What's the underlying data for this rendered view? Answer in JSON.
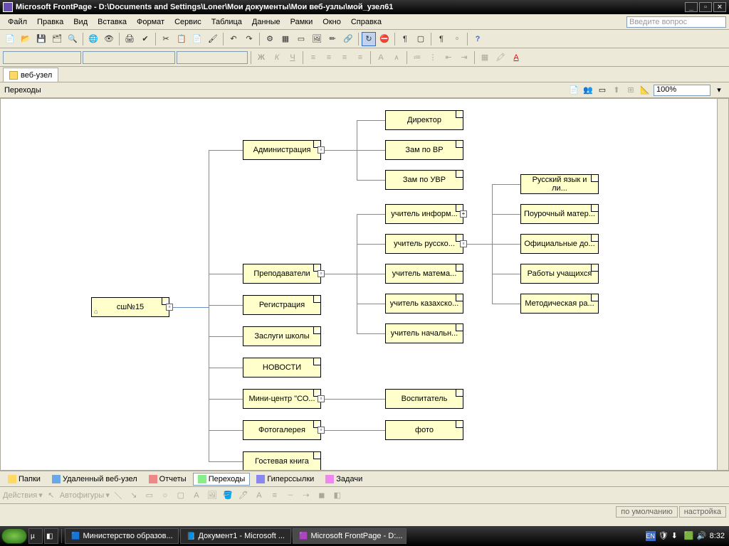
{
  "titlebar": {
    "app": "Microsoft FrontPage",
    "path": "D:\\Documents and Settings\\Loner\\Мои документы\\Мои веб-узлы\\мой_узел61"
  },
  "menu": {
    "file": "Файл",
    "edit": "Правка",
    "view": "Вид",
    "insert": "Вставка",
    "format": "Формат",
    "service": "Сервис",
    "table": "Таблица",
    "data": "Данные",
    "frames": "Рамки",
    "window": "Окно",
    "help": "Справка",
    "question_placeholder": "Введите вопрос"
  },
  "tab": {
    "label": "веб-узел"
  },
  "viewbar": {
    "label": "Переходы",
    "zoom": "100%"
  },
  "nodes": {
    "root": "сш№15",
    "admin": "Администрация",
    "teachers": "Преподаватели",
    "register": "Регистрация",
    "merits": "Заслуги школы",
    "news": "НОВОСТИ",
    "minicenter": "Мини-центр \"СО...",
    "gallery": "Фотогалерея",
    "guestbook": "Гостевая книга",
    "director": "Директор",
    "zamvr": "Зам по ВР",
    "zamuvr": "Зам по УВР",
    "t_inform": "учитель информ...",
    "t_rus": "учитель русско...",
    "t_math": "учитель матема...",
    "t_kaz": "учитель казахско...",
    "t_elem": "учитель начальн...",
    "ruslit": "Русский язык и ли...",
    "lesson": "Поурочный матер...",
    "official": "Официальные до...",
    "works": "Работы учащихся",
    "method": "Методическая ра...",
    "educator": "Воспитатель",
    "photo": "фото"
  },
  "bottomtabs": {
    "folders": "Папки",
    "remote": "Удаленный веб-узел",
    "reports": "Отчеты",
    "navigation": "Переходы",
    "hyperlinks": "Гиперссылки",
    "tasks": "Задачи"
  },
  "actionsbar": {
    "actions": "Действия",
    "autoshapes": "Автофигуры"
  },
  "statusbar": {
    "default": "по умолчанию",
    "custom": "настройка"
  },
  "taskbar": {
    "item1": "Министерство образов...",
    "item2": "Документ1 - Microsoft ...",
    "item3": "Microsoft FrontPage - D:...",
    "lang": "EN",
    "time": "8:32"
  }
}
